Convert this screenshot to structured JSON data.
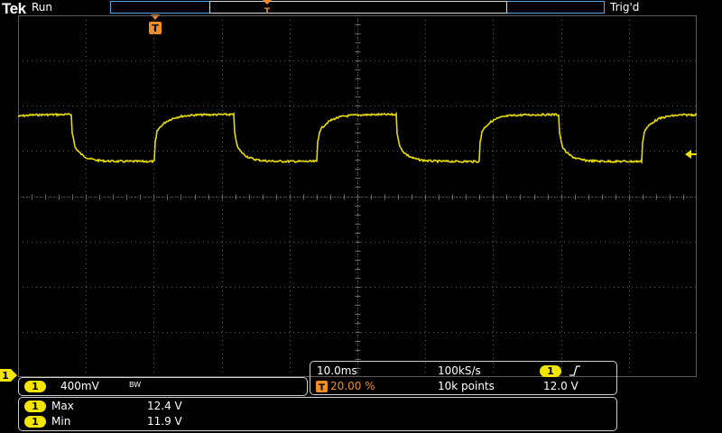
{
  "header": {
    "brand": "Tek",
    "acq_state": "Run",
    "trigger_status": "Trig'd"
  },
  "trigger_marker": "T",
  "channel": {
    "number": "1",
    "scale": "400mV",
    "bandwidth_badge": "BW",
    "color": "#f2e600"
  },
  "timebase": {
    "horizontal_scale": "10.0ms",
    "sample_rate": "100kS/s",
    "trigger_position": "20.00 %",
    "record_length": "10k points"
  },
  "trigger": {
    "source": "1",
    "slope_icon": "rising-edge-icon",
    "level": "12.0 V"
  },
  "measurements": [
    {
      "source": "1",
      "name": "Max",
      "value": "12.4 V"
    },
    {
      "source": "1",
      "name": "Min",
      "value": "11.9 V"
    }
  ],
  "colors": {
    "trace": "#e8dc00",
    "trigger_orange": "#f28c28",
    "grid": "#5a5a5a"
  }
}
